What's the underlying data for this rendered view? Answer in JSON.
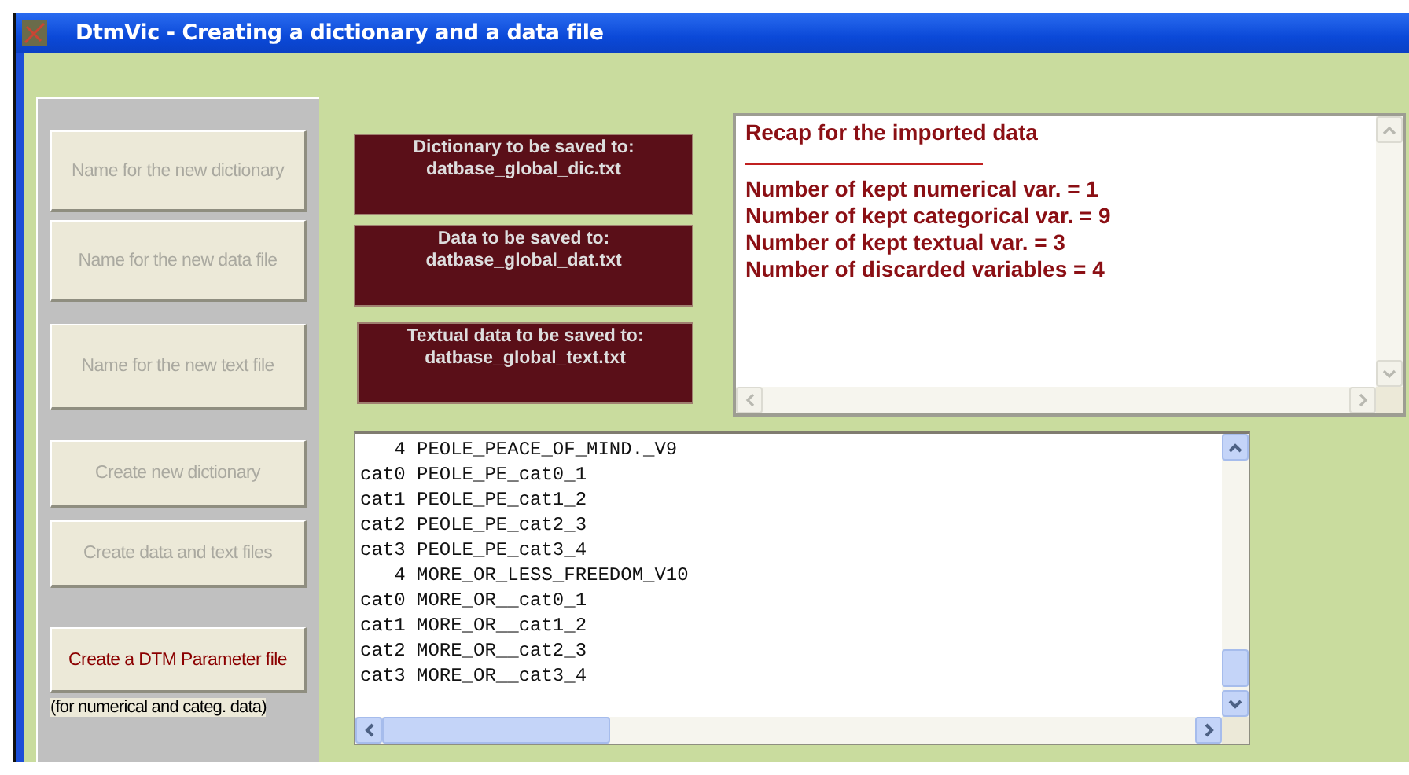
{
  "window": {
    "title": "DtmVic - Creating a dictionary and a data file"
  },
  "buttons": [
    {
      "label": "Name for the new dictionary",
      "disabled": true
    },
    {
      "label": "Name for the new data file",
      "disabled": true
    },
    {
      "label": "Name for the new text file",
      "disabled": true
    },
    {
      "label": "Create new dictionary",
      "disabled": true
    },
    {
      "label": "Create data and text files",
      "disabled": true
    },
    {
      "label": "Create a DTM Parameter file",
      "disabled": false
    }
  ],
  "button_note": "(for numerical and categ. data)",
  "save_targets": [
    {
      "caption": "Dictionary to be saved to:",
      "file": "datbase_global_dic.txt"
    },
    {
      "caption": "Data to be saved to:",
      "file": "datbase_global_dat.txt"
    },
    {
      "caption": "Textual data to be saved to:",
      "file": "datbase_global_text.txt"
    }
  ],
  "recap": {
    "title": "Recap for the imported data",
    "lines": [
      "Number of kept numerical var. = 1",
      "Number of kept categorical var. = 9",
      "Number of kept textual var. = 3",
      "Number of discarded variables = 4"
    ]
  },
  "listing": {
    "lines": [
      "   4 PEOLE_PEACE_OF_MIND._V9",
      "cat0 PEOLE_PE_cat0_1",
      "cat1 PEOLE_PE_cat1_2",
      "cat2 PEOLE_PE_cat2_3",
      "cat3 PEOLE_PE_cat3_4",
      "   4 MORE_OR_LESS_FREEDOM_V10",
      "cat0 MORE_OR__cat0_1",
      "cat1 MORE_OR__cat1_2",
      "cat2 MORE_OR__cat2_3",
      "cat3 MORE_OR__cat3_4"
    ]
  }
}
